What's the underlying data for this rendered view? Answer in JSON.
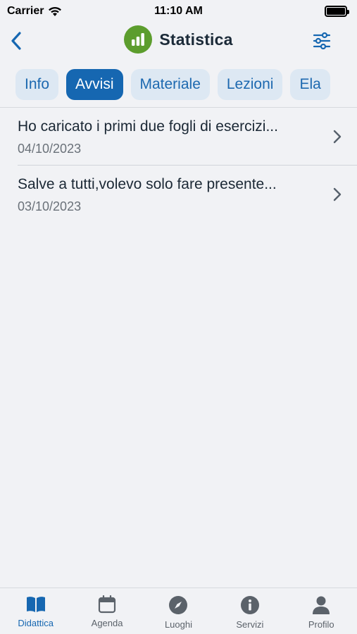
{
  "status_bar": {
    "carrier": "Carrier",
    "time": "11:10 AM"
  },
  "header": {
    "title": "Statistica"
  },
  "tabs": [
    {
      "label": "Info",
      "active": false
    },
    {
      "label": "Avvisi",
      "active": true
    },
    {
      "label": "Materiale",
      "active": false
    },
    {
      "label": "Lezioni",
      "active": false
    },
    {
      "label": "Ela",
      "active": false
    }
  ],
  "notices": [
    {
      "title": "Ho caricato i primi due fogli di esercizi...",
      "date": "04/10/2023"
    },
    {
      "title": "Salve a tutti,volevo solo fare presente...",
      "date": "03/10/2023"
    }
  ],
  "tabbar": [
    {
      "label": "Didattica",
      "icon": "book-icon",
      "active": true
    },
    {
      "label": "Agenda",
      "icon": "calendar-icon",
      "active": false
    },
    {
      "label": "Luoghi",
      "icon": "compass-icon",
      "active": false
    },
    {
      "label": "Servizi",
      "icon": "info-icon",
      "active": false
    },
    {
      "label": "Profilo",
      "icon": "person-icon",
      "active": false
    }
  ],
  "colors": {
    "accent": "#1667b1",
    "tab_bg": "#dde8f3",
    "course_logo": "#5c9d2d",
    "background": "#f1f2f5"
  }
}
